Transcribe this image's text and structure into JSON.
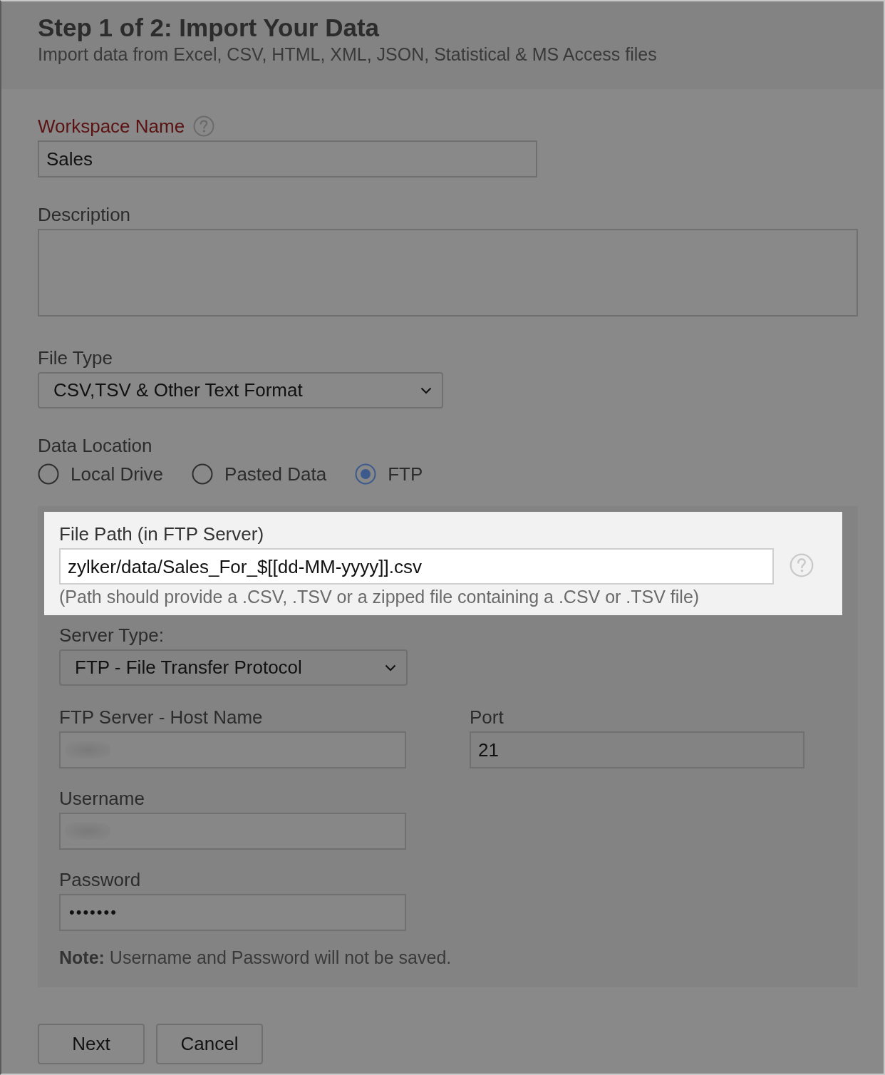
{
  "header": {
    "title": "Step 1 of 2: Import Your Data",
    "subtitle": "Import data from Excel, CSV, HTML, XML, JSON, Statistical & MS Access files"
  },
  "form": {
    "workspace_name": {
      "label": "Workspace Name",
      "required": true,
      "value": "Sales"
    },
    "description": {
      "label": "Description"
    },
    "file_type": {
      "label": "File Type",
      "value": "CSV,TSV & Other Text Format"
    },
    "data_location": {
      "label": "Data Location",
      "options": [
        {
          "label": "Local Drive",
          "selected": false
        },
        {
          "label": "Pasted Data",
          "selected": false
        },
        {
          "label": "FTP",
          "selected": true
        }
      ]
    },
    "ftp": {
      "file_path": {
        "label": "File Path (in FTP Server)",
        "value": "zylker/data/Sales_For_$[[dd-MM-yyyy]].csv",
        "hint": "(Path should provide a .CSV, .TSV or a zipped file containing a .CSV or .TSV file)",
        "highlighted": true
      },
      "server_type": {
        "label": "Server Type:",
        "value": "FTP - File Transfer Protocol"
      },
      "host_name": {
        "label": "FTP Server - Host Name",
        "redacted": true
      },
      "port": {
        "label": "Port",
        "value": "21"
      },
      "username": {
        "label": "Username",
        "redacted": true
      },
      "password": {
        "label": "Password",
        "value": "•••••••"
      },
      "note": "**Note:** Username and Password will not be saved."
    }
  },
  "buttons": [
    {
      "label": "Next"
    },
    {
      "label": "Cancel"
    }
  ]
}
